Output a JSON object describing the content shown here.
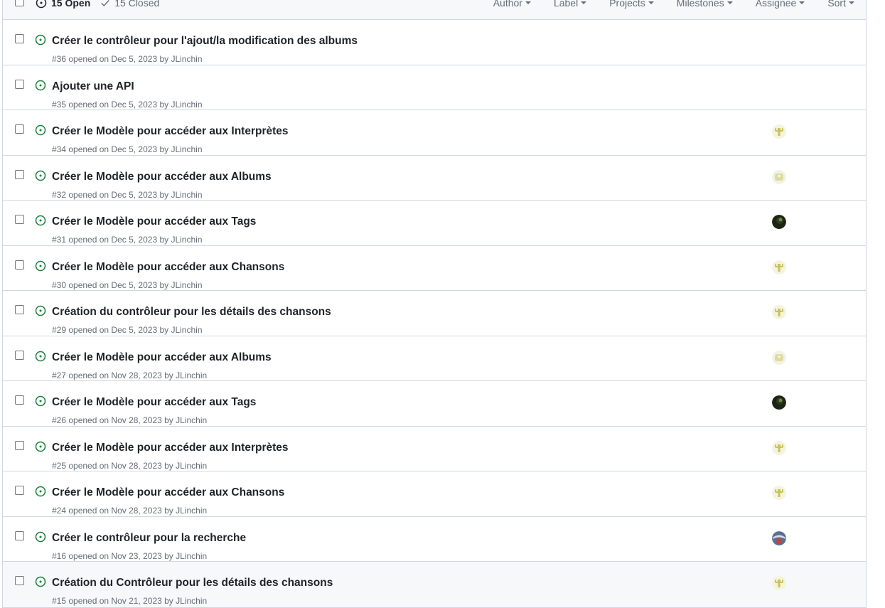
{
  "header": {
    "open_label": "15 Open",
    "closed_label": "15 Closed",
    "filters": [
      "Author",
      "Label",
      "Projects",
      "Milestones",
      "Assignee",
      "Sort"
    ]
  },
  "issues": [
    {
      "title": "Créer le contrôleur pour l'ajout/la modification des albums",
      "meta": "#36 opened on Dec 5, 2023 by JLinchin",
      "avatar": "none"
    },
    {
      "title": "Ajouter une API",
      "meta": "#35 opened on Dec 5, 2023 by JLinchin",
      "avatar": "none"
    },
    {
      "title": "Créer le Modèle pour accéder aux Interprètes",
      "meta": "#34 opened on Dec 5, 2023 by JLinchin",
      "avatar": "olive"
    },
    {
      "title": "Créer le Modèle pour accéder aux Albums",
      "meta": "#32 opened on Dec 5, 2023 by JLinchin",
      "avatar": "pale"
    },
    {
      "title": "Créer le Modèle pour accéder aux Tags",
      "meta": "#31 opened on Dec 5, 2023 by JLinchin",
      "avatar": "dark"
    },
    {
      "title": "Créer le Modèle pour accéder aux Chansons",
      "meta": "#30 opened on Dec 5, 2023 by JLinchin",
      "avatar": "olive"
    },
    {
      "title": "Création du contrôleur pour les détails des chansons",
      "meta": "#29 opened on Dec 5, 2023 by JLinchin",
      "avatar": "olive"
    },
    {
      "title": "Créer le Modèle pour accéder aux Albums",
      "meta": "#27 opened on Nov 28, 2023 by JLinchin",
      "avatar": "pale"
    },
    {
      "title": "Créer le Modèle pour accéder aux Tags",
      "meta": "#26 opened on Nov 28, 2023 by JLinchin",
      "avatar": "dark"
    },
    {
      "title": "Créer le Modèle pour accéder aux Interprètes",
      "meta": "#25 opened on Nov 28, 2023 by JLinchin",
      "avatar": "olive"
    },
    {
      "title": "Créer le Modèle pour accéder aux Chansons",
      "meta": "#24 opened on Nov 28, 2023 by JLinchin",
      "avatar": "olive"
    },
    {
      "title": "Créer le contrôleur pour la recherche",
      "meta": "#16 opened on Nov 23, 2023 by JLinchin",
      "avatar": "globe"
    },
    {
      "title": "Création du Contrôleur pour les détails des chansons",
      "meta": "#15 opened on Nov 21, 2023 by JLinchin",
      "avatar": "olive"
    }
  ],
  "colors": {
    "open_icon": "#1a7f37",
    "border": "#d0d7de",
    "muted": "#656d76",
    "avatar_olive": "#c9c25a",
    "avatar_pale": "#dcdca0",
    "avatar_dark": "#2d3a1f",
    "avatar_globe": "#5a6e96"
  }
}
